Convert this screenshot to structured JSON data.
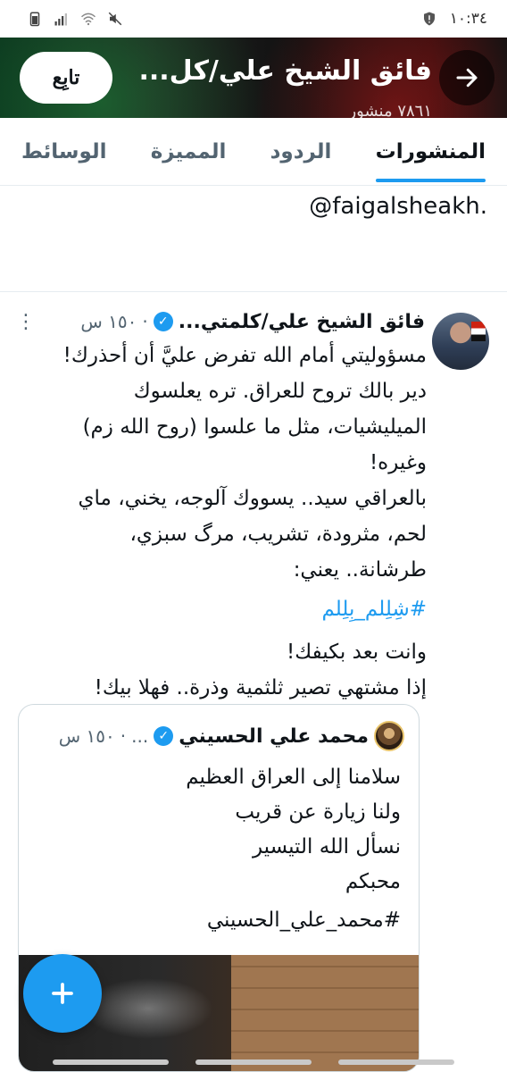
{
  "status_bar": {
    "time": "١٠:٣٤",
    "icons": [
      "alert-shield-icon",
      "mute-icon",
      "wifi-icon",
      "signal-icon",
      "battery-icon"
    ]
  },
  "profile_header": {
    "title": "فائق الشيخ علي/كل...",
    "subtitle": "٧٨٦١ منشور",
    "follow_label": "تابِع",
    "back_icon": "arrow-icon"
  },
  "tabs": [
    {
      "label": "المنشورات",
      "active": true
    },
    {
      "label": "الردود",
      "active": false
    },
    {
      "label": "المميزة",
      "active": false
    },
    {
      "label": "الوسائط",
      "active": false
    }
  ],
  "bio_handle": "@faigalsheakh.",
  "tweet": {
    "author": "فائق الشيخ علي/كلمتي...",
    "time": "١٥٠ س",
    "lines": [
      "مسؤوليتي أمام الله تفرض عليَّ أن أحذرك!",
      "دير بالك تروح للعراق. تره يعلسوك",
      "الميليشيات، مثل ما علسوا (روح الله زم)",
      "وغيره!",
      "بالعراقي سيد.. يسووك آلوجه، يخني، ماي",
      "لحم، مثرودة، تشريب، مرگ سبزي،",
      "طرشانة.. يعني:"
    ],
    "hashtag": "#شِلِلم_بِلِلم",
    "lines2": [
      "وانت بعد بكيفك!",
      "إذا مشتهي تصير ثلثمية وذرة.. فهلا بيك!"
    ]
  },
  "quoted_tweet": {
    "author": "محمد علي الحسيني",
    "time": "١٥٠ س",
    "lines": [
      "سلامنا إلى العراق العظيم",
      "ولنا زيارة عن قريب",
      "نسأل الله التيسير",
      "محبكم",
      "#محمد_علي_الحسيني"
    ]
  },
  "colors": {
    "accent": "#1d9bf0",
    "text": "#0f1419",
    "muted": "#536471"
  }
}
